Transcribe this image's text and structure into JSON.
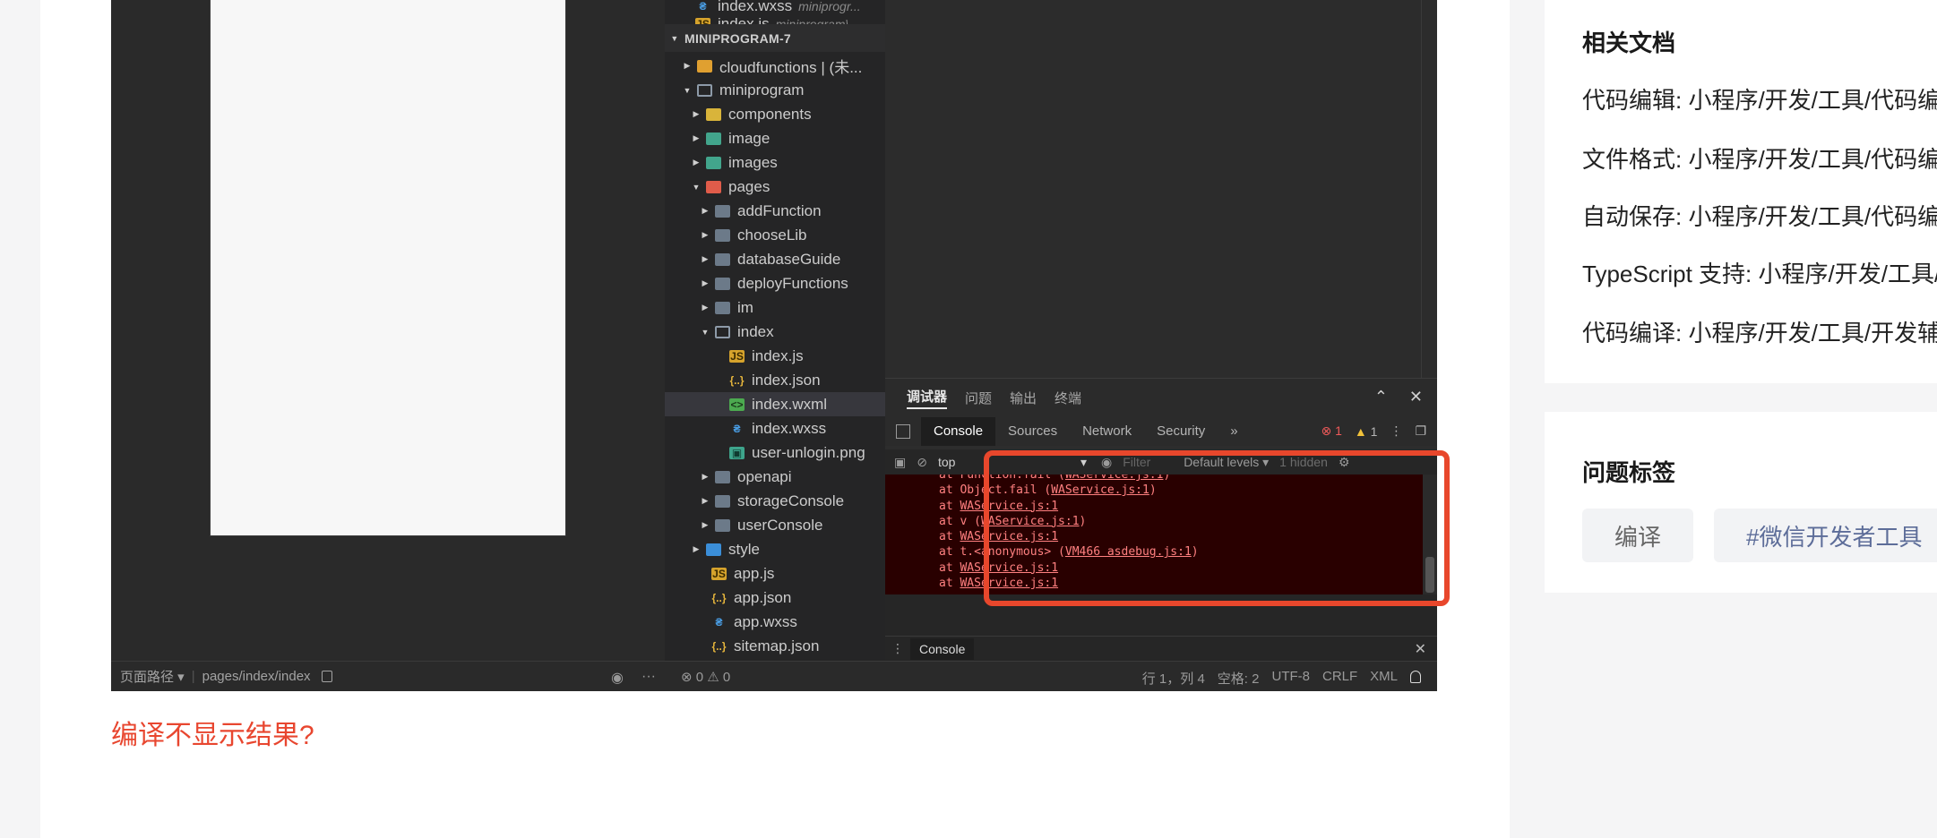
{
  "simulator": {
    "path_label": "页面路径",
    "path_value": "pages/index/index"
  },
  "explorer": {
    "project": "MINIPROGRAM-7",
    "top_items": [
      {
        "name": "index.wxss",
        "hint": "miniprogr..."
      },
      {
        "name": "index.js",
        "hint": "miniprogram\\..."
      }
    ],
    "items": [
      {
        "name": "cloudfunctions | (未...",
        "icon": "cloud-folder-icon"
      },
      {
        "name": "miniprogram",
        "icon": "folder-open-icon"
      },
      {
        "name": "components",
        "icon": "components-folder-icon"
      },
      {
        "name": "image",
        "icon": "image-folder-icon"
      },
      {
        "name": "images",
        "icon": "image-folder-icon"
      },
      {
        "name": "pages",
        "icon": "pages-folder-icon"
      },
      {
        "name": "addFunction",
        "icon": "folder-icon"
      },
      {
        "name": "chooseLib",
        "icon": "folder-icon"
      },
      {
        "name": "databaseGuide",
        "icon": "folder-icon"
      },
      {
        "name": "deployFunctions",
        "icon": "folder-icon"
      },
      {
        "name": "im",
        "icon": "folder-icon"
      },
      {
        "name": "index",
        "icon": "folder-open-icon"
      },
      {
        "name": "index.js",
        "icon": "js-file-icon"
      },
      {
        "name": "index.json",
        "icon": "json-file-icon"
      },
      {
        "name": "index.wxml",
        "icon": "wxml-file-icon"
      },
      {
        "name": "index.wxss",
        "icon": "wxss-file-icon"
      },
      {
        "name": "user-unlogin.png",
        "icon": "png-file-icon"
      },
      {
        "name": "openapi",
        "icon": "folder-icon"
      },
      {
        "name": "storageConsole",
        "icon": "folder-icon"
      },
      {
        "name": "userConsole",
        "icon": "folder-icon"
      },
      {
        "name": "style",
        "icon": "style-folder-icon"
      },
      {
        "name": "app.js",
        "icon": "js-file-icon"
      },
      {
        "name": "app.json",
        "icon": "json-file-icon"
      },
      {
        "name": "app.wxss",
        "icon": "wxss-file-icon"
      },
      {
        "name": "sitemap.json",
        "icon": "json-file-icon"
      }
    ]
  },
  "debug_panel": {
    "tabs": [
      "调试器",
      "问题",
      "输出",
      "终端"
    ],
    "devtools_tabs": [
      "Console",
      "Sources",
      "Network",
      "Security",
      "»"
    ],
    "error_count": "1",
    "warning_count": "1",
    "context": "top",
    "filter_placeholder": "Filter",
    "levels": "Default levels ▾",
    "hidden": "1 hidden",
    "console_lines": [
      {
        "pre": "at Function.fail (",
        "link": "WAService.js:1",
        "post": ")"
      },
      {
        "pre": "at Object.fail (",
        "link": "WAService.js:1",
        "post": ")"
      },
      {
        "pre": "at ",
        "link": "WAService.js:1",
        "post": ""
      },
      {
        "pre": "at v (",
        "link": "WAService.js:1",
        "post": ")"
      },
      {
        "pre": "at ",
        "link": "WAService.js:1",
        "post": ""
      },
      {
        "pre": "at t.<anonymous> (",
        "link": "VM466 asdebug.js:1",
        "post": ")"
      },
      {
        "pre": "at ",
        "link": "WAService.js:1",
        "post": ""
      },
      {
        "pre": "at ",
        "link": "WAService.js:1",
        "post": ""
      }
    ],
    "drawer_tab": "Console"
  },
  "status_bar": {
    "problems": "⊗ 0 ⚠ 0",
    "position": "行 1，列 4",
    "spaces": "空格: 2",
    "encoding": "UTF-8",
    "eol": "CRLF",
    "language": "XML"
  },
  "post": {
    "question_link": "编译不显示结果?"
  },
  "sidebar": {
    "docs_title": "相关文档",
    "docs": [
      "代码编辑: 小程序/开发/工具/代码编辑",
      "文件格式: 小程序/开发/工具/代码编辑",
      "自动保存: 小程序/开发/工具/代码编辑",
      "TypeScript 支持: 小程序/开发/工具/代码编辑",
      "代码编译: 小程序/开发/工具/开发辅助"
    ],
    "tags_title": "问题标签",
    "tags": [
      "编译",
      "#微信开发者工具"
    ]
  },
  "colors": {
    "highlight": "#e8472c",
    "question_link": "#e8462f",
    "tag_topic": "#5d6d99"
  }
}
